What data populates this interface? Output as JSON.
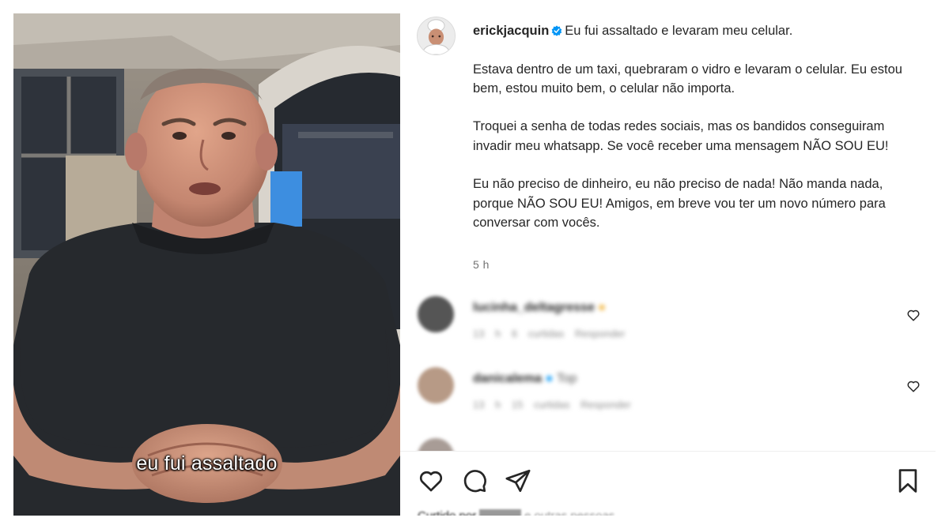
{
  "video": {
    "caption": "eu fui assaltado"
  },
  "post": {
    "username": "erickjacquin",
    "verified": true,
    "paragraphs": [
      "Eu fui assaltado e levaram meu celular.",
      "Estava dentro de um taxi, quebraram o vidro e levaram o celular. Eu estou bem, estou muito bem, o celular não importa.",
      "Troquei a senha de todas redes sociais, mas os bandidos conseguiram invadir meu whatsapp. Se você receber uma mensagem NÃO SOU EU!",
      "Eu não preciso de dinheiro, eu não preciso de nada! Não manda nada, porque NÃO SOU EU! Amigos, em breve vou ter um novo número para conversar com vocês."
    ],
    "timestamp": "5 h"
  },
  "comments": [
    {
      "username": "lucinha_deltagresse",
      "text": "",
      "meta": "13 h   6 curtidas   Responder",
      "avatar_color": "#555555"
    },
    {
      "username": "danicalema",
      "text": "Top",
      "meta": "13 h   15 curtidas   Responder",
      "avatar_color": "#b79a86"
    }
  ],
  "actions": {
    "like": "heart-icon",
    "comment": "comment-icon",
    "share": "share-icon",
    "save": "bookmark-icon",
    "liked_by": "Curtido por"
  },
  "colors": {
    "text": "#262626",
    "muted": "#737373",
    "verified": "#0095f6",
    "background": "#ffffff"
  }
}
